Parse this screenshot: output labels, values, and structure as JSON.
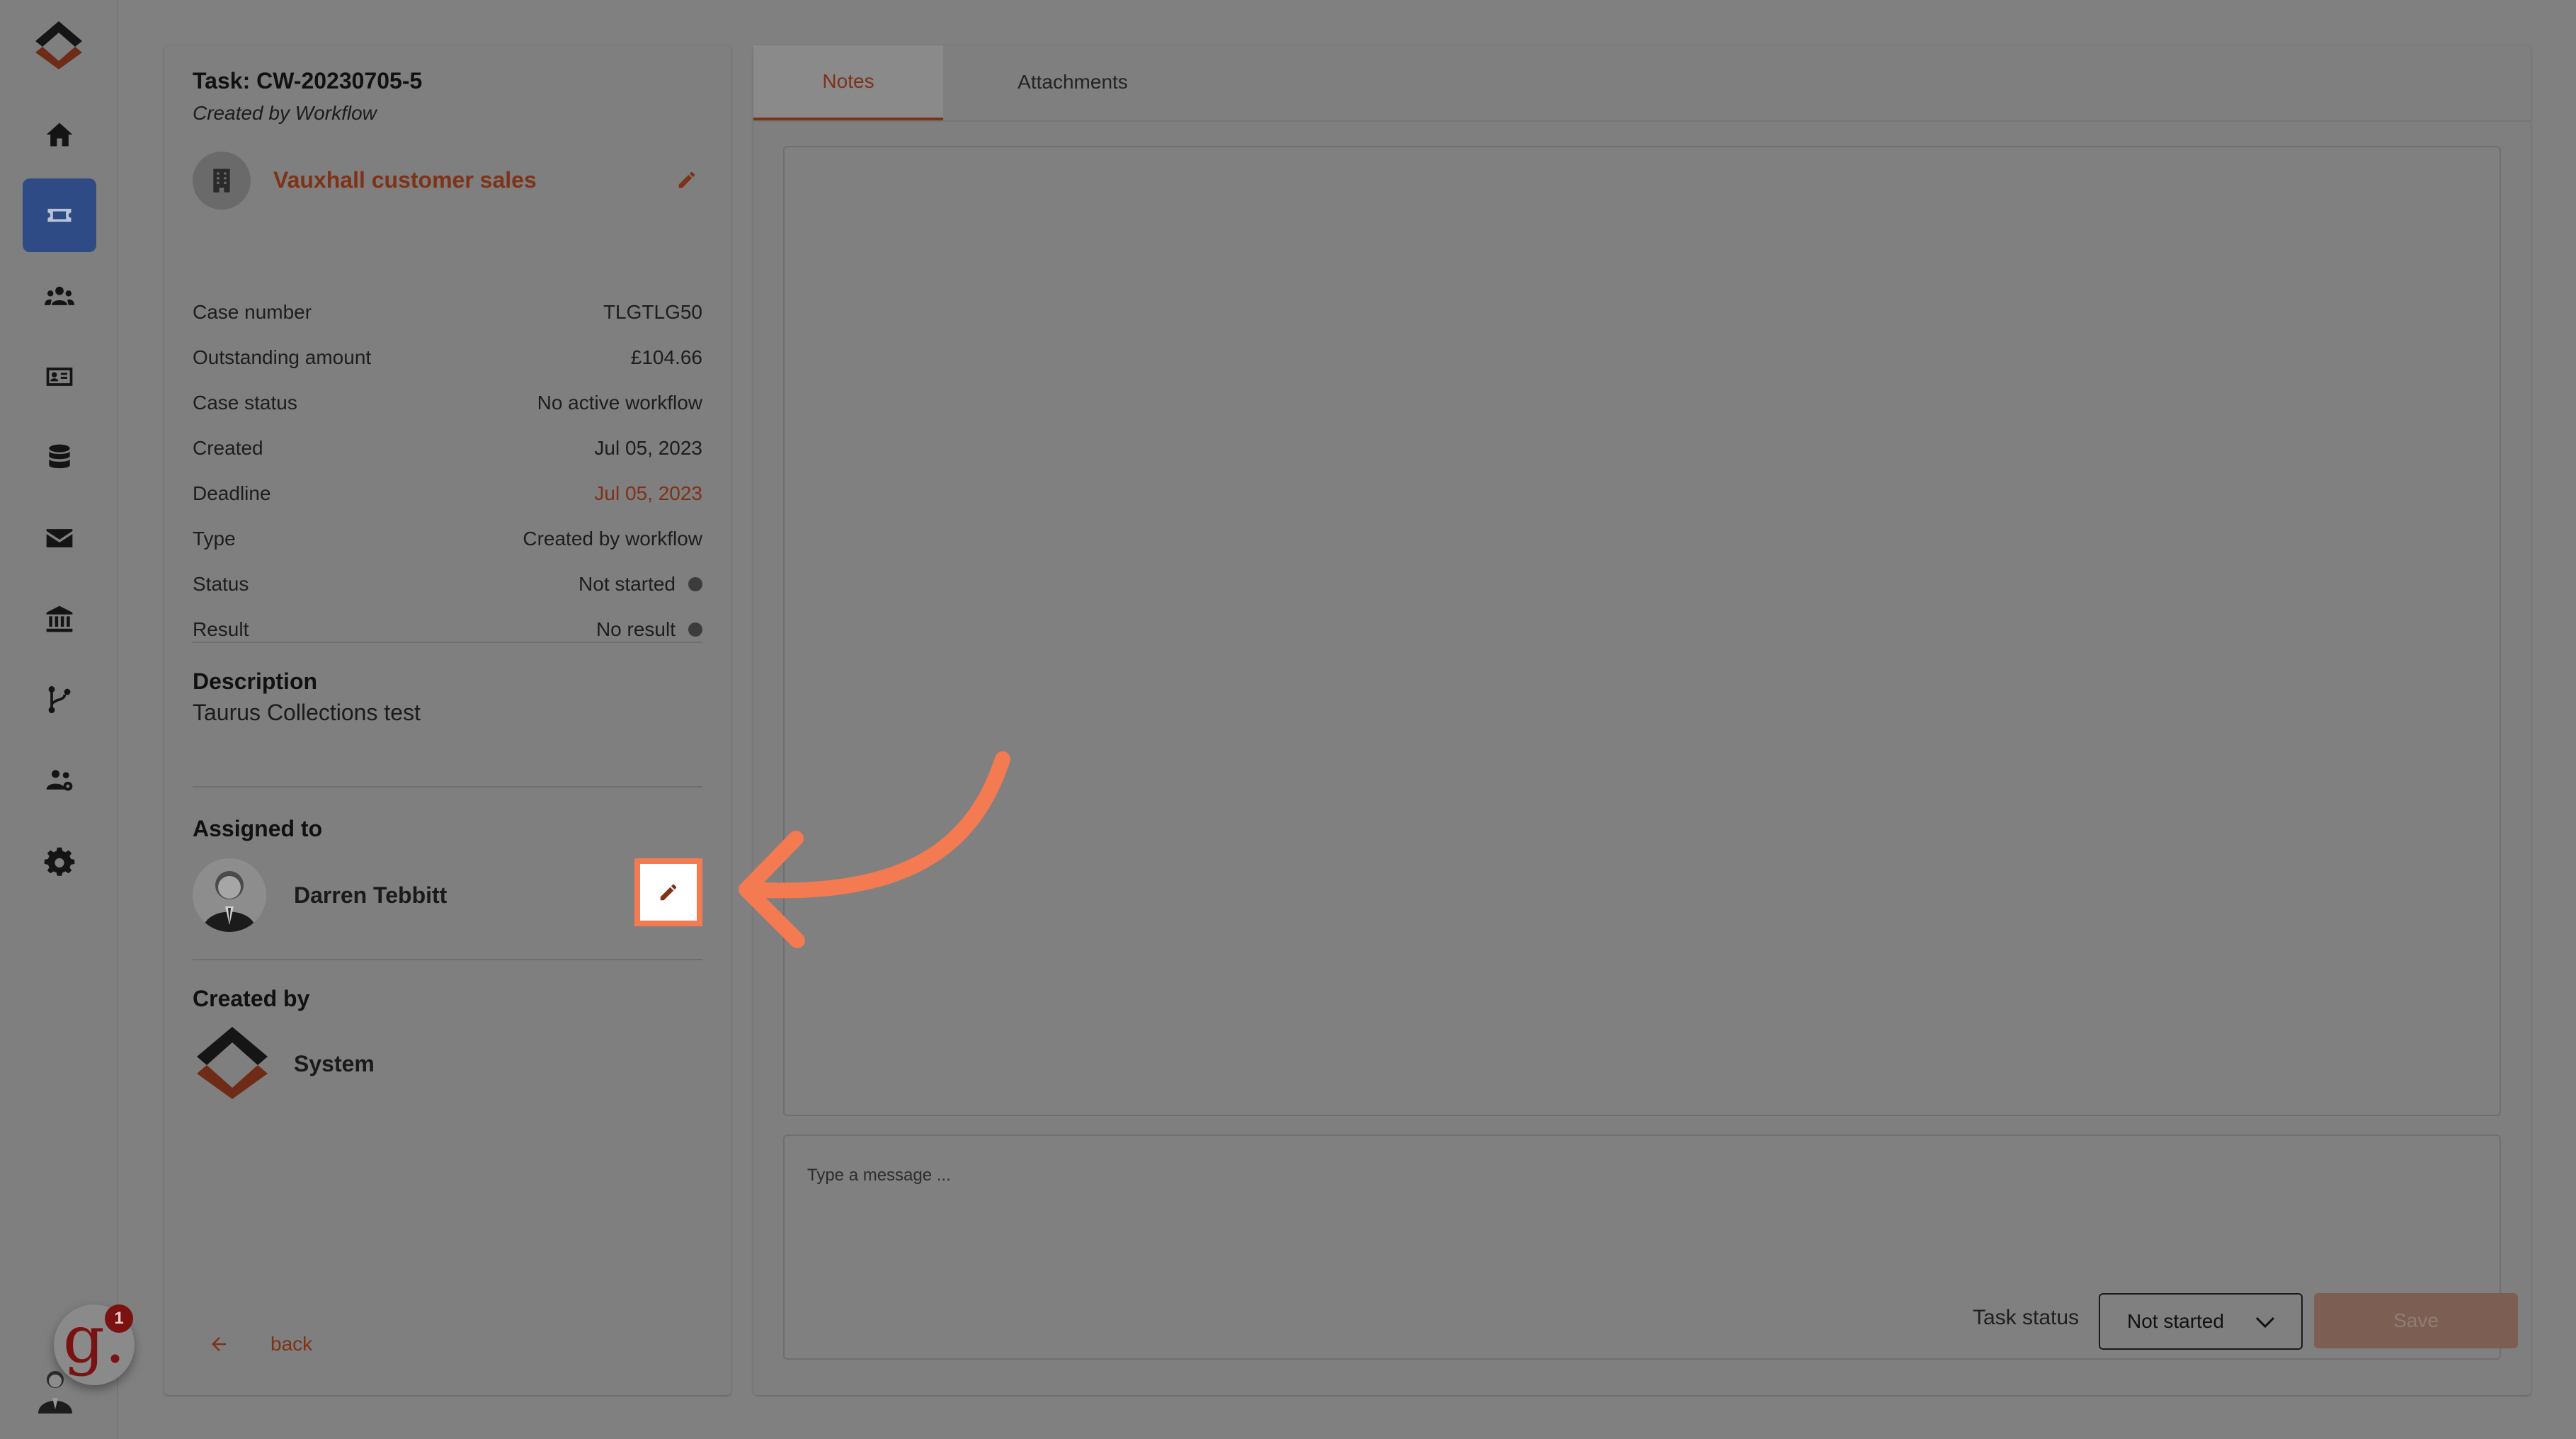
{
  "task": {
    "title": "Task: CW-20230705-5",
    "subtitle": "Created by Workflow"
  },
  "company": {
    "name": "Vauxhall customer sales",
    "icon": "building-icon"
  },
  "details": [
    {
      "label": "Case number",
      "value": "TLGTLG50"
    },
    {
      "label": "Outstanding amount",
      "value": "£104.66"
    },
    {
      "label": "Case status",
      "value": "No active workflow"
    },
    {
      "label": "Created",
      "value": "Jul 05, 2023"
    },
    {
      "label": "Deadline",
      "value": "Jul 05, 2023"
    },
    {
      "label": "Type",
      "value": "Created by workflow"
    },
    {
      "label": "Status",
      "value": "Not started"
    },
    {
      "label": "Result",
      "value": "No result"
    }
  ],
  "description": {
    "heading": "Description",
    "text": "Taurus Collections test"
  },
  "assigned": {
    "heading": "Assigned to",
    "name": "Darren Tebbitt"
  },
  "created_by": {
    "heading": "Created by",
    "name": "System"
  },
  "back_label": "back",
  "tabs": {
    "notes": "Notes",
    "attachments": "Attachments"
  },
  "composer": {
    "placeholder": "Type a message ...",
    "status_label": "Task status",
    "status_value": "Not started",
    "save_label": "Save"
  },
  "notification_badge": {
    "letter": "g.",
    "count": "1"
  },
  "nav_icons": [
    "home-icon",
    "ticket-icon",
    "users-icon",
    "id-card-icon",
    "database-icon",
    "mail-icon",
    "bank-icon",
    "branch-icon",
    "team-icon",
    "gear-icon"
  ],
  "colors": {
    "accent": "#7e3218",
    "nav_active": "#2f4b86",
    "highlight": "#f47a52",
    "overlay_background": "#808080"
  }
}
